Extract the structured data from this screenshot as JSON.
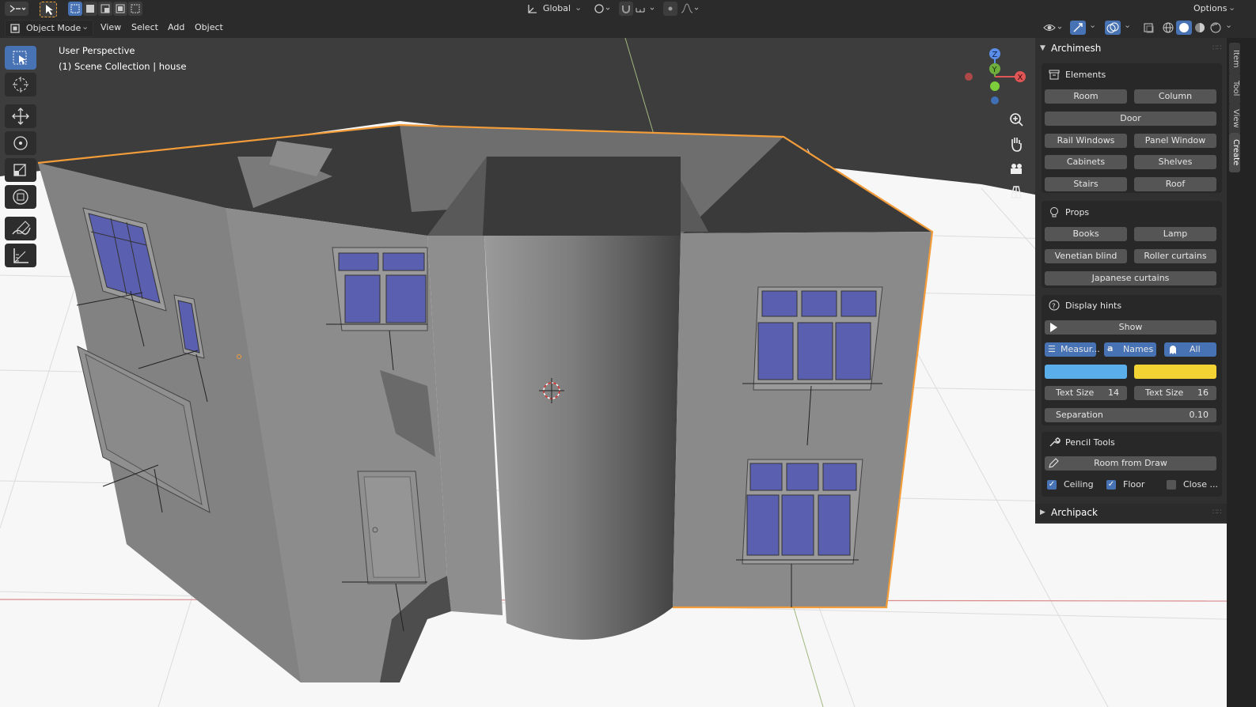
{
  "header": {
    "transform_orientation": "Global",
    "options_label": "Options"
  },
  "menubar": {
    "mode": "Object Mode",
    "menus": [
      "View",
      "Select",
      "Add",
      "Object"
    ]
  },
  "viewport": {
    "perspective_label": "User Perspective",
    "collection_label": "(1) Scene Collection | house",
    "gizmo": {
      "x": "X",
      "y": "Y",
      "z": "Z"
    }
  },
  "sidebar_tabs": [
    "Item",
    "Tool",
    "View",
    "Create"
  ],
  "panel": {
    "title": "Archimesh",
    "elements": {
      "header": "Elements",
      "buttons": [
        "Room",
        "Column",
        "Door",
        "Rail Windows",
        "Panel Window",
        "Cabinets",
        "Shelves",
        "Stairs",
        "Roof"
      ]
    },
    "props": {
      "header": "Props",
      "buttons": [
        "Books",
        "Lamp",
        "Venetian blind",
        "Roller curtains",
        "Japanese curtains"
      ]
    },
    "display_hints": {
      "header": "Display hints",
      "show": "Show",
      "toggles": [
        "Measur...",
        "Names",
        "All"
      ],
      "color1": "#5aaeea",
      "color2": "#f2d333",
      "text_size_1_label": "Text Size",
      "text_size_1_value": "14",
      "text_size_2_label": "Text Size",
      "text_size_2_value": "16",
      "separation_label": "Separation",
      "separation_value": "0.10"
    },
    "pencil": {
      "header": "Pencil Tools",
      "room_from_draw": "Room from Draw",
      "checks": [
        "Ceiling",
        "Floor",
        "Close ..."
      ]
    },
    "archipack": "Archipack"
  },
  "colors": {
    "accent": "#4772b3",
    "selection_outline": "#f39c3a",
    "window_glass": "#5a5fb0"
  }
}
